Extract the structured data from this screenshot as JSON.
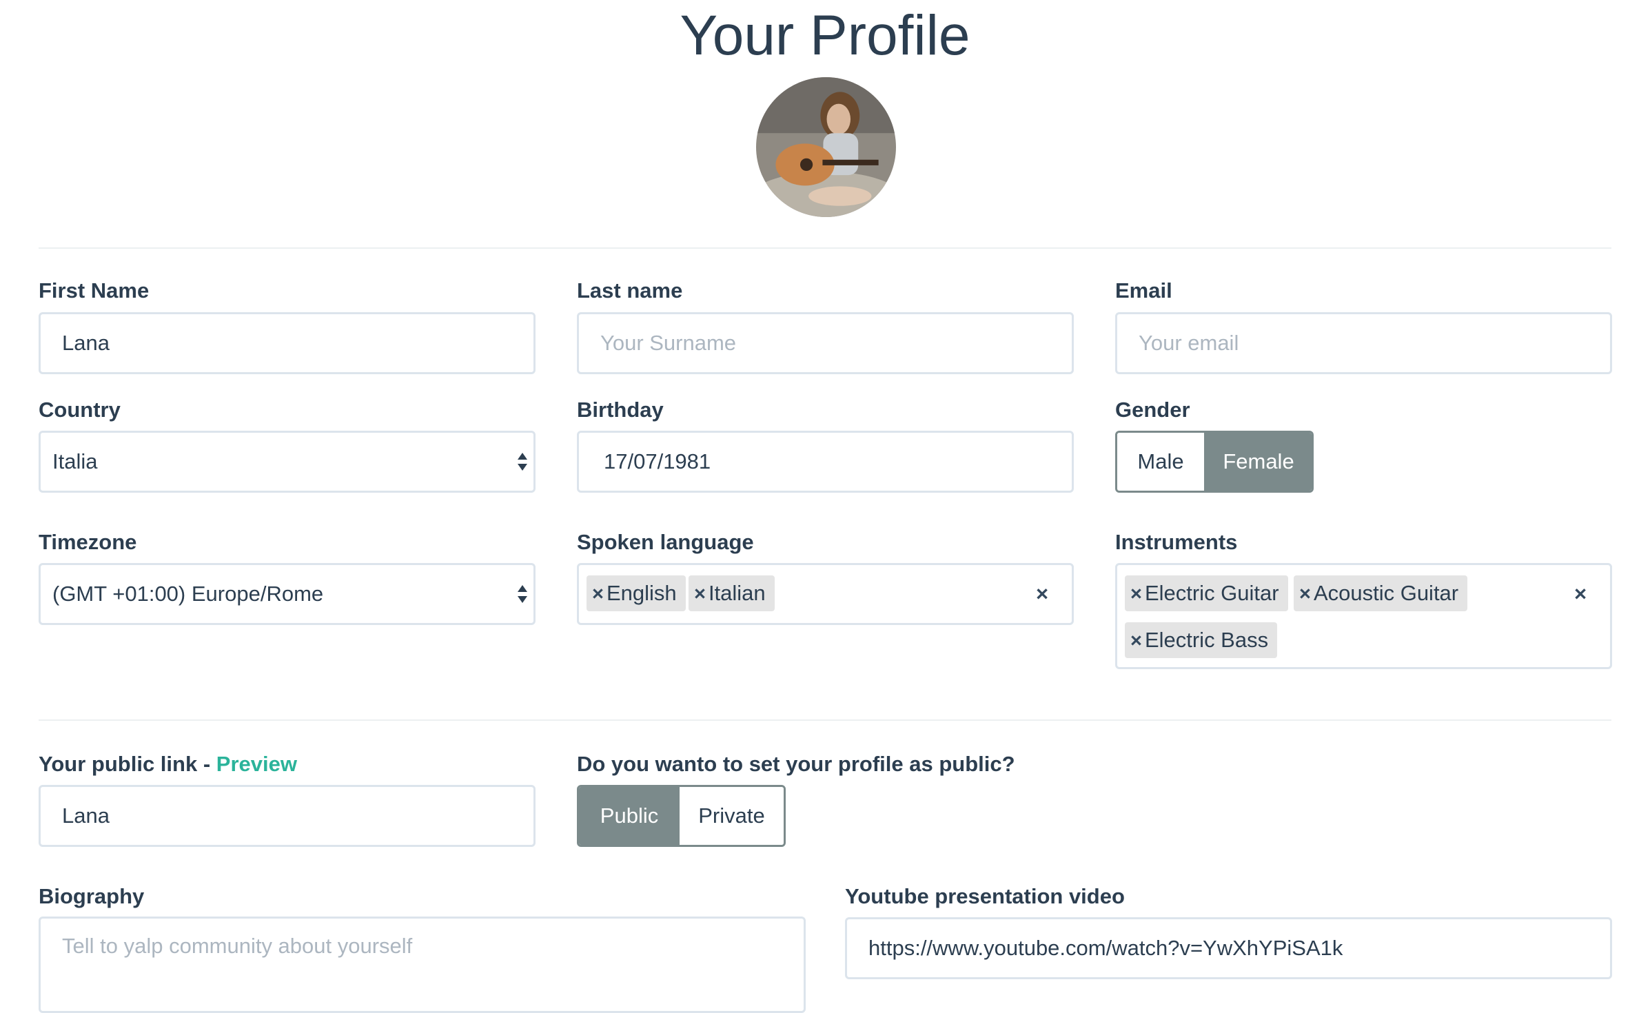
{
  "page": {
    "title": "Your Profile"
  },
  "profile": {
    "first_name": {
      "label": "First Name",
      "value": "Lana"
    },
    "last_name": {
      "label": "Last name",
      "placeholder": "Your Surname"
    },
    "email": {
      "label": "Email",
      "placeholder": "Your email"
    },
    "country": {
      "label": "Country",
      "value": "Italia"
    },
    "birthday": {
      "label": "Birthday",
      "value": "17/07/1981"
    },
    "gender": {
      "label": "Gender",
      "options": [
        "Male",
        "Female"
      ],
      "selected": "Female"
    },
    "timezone": {
      "label": "Timezone",
      "value": "(GMT +01:00) Europe/Rome"
    },
    "spoken_language": {
      "label": "Spoken language",
      "tags": [
        "English",
        "Italian"
      ]
    },
    "instruments": {
      "label": "Instruments",
      "tags": [
        "Electric Guitar",
        "Acoustic Guitar",
        "Electric Bass"
      ]
    }
  },
  "public": {
    "link_label": "Your public link - ",
    "preview_label": "Preview",
    "link_value": "Lana",
    "visibility_label": "Do you wanto to set your profile as public?",
    "options": [
      "Public",
      "Private"
    ],
    "selected": "Public"
  },
  "bio": {
    "label": "Biography",
    "placeholder": "Tell to yalp community about yourself"
  },
  "youtube": {
    "label": "Youtube presentation video",
    "value": "https://www.youtube.com/watch?v=YwXhYPiSA1k"
  },
  "icons": {
    "remove": "close-icon",
    "select": "select-arrows-icon",
    "clear": "clear-icon"
  },
  "colors": {
    "accent": "#2bb39a",
    "segment_active": "#7b8a8b",
    "border": "#dce4ec",
    "text": "#2c3e50",
    "tag_bg": "#e4e4e4"
  }
}
